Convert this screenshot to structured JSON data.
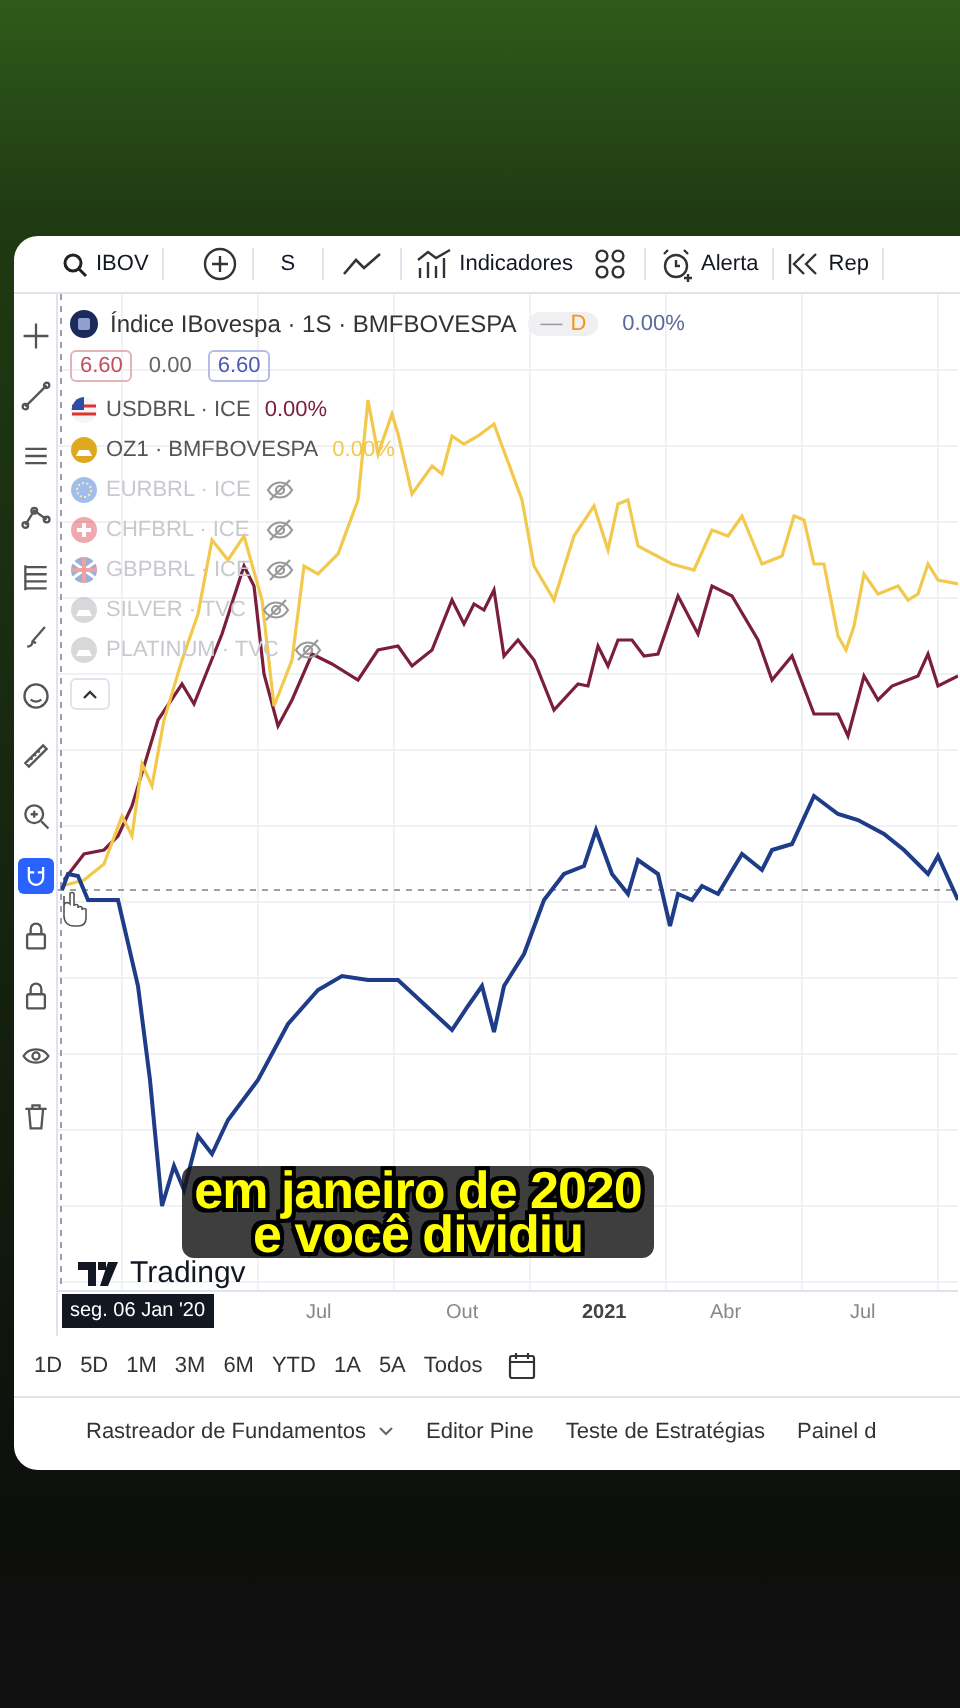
{
  "toolbar": {
    "symbol": "IBOV",
    "interval": "S",
    "buttons": [
      {
        "kind": "indicators",
        "label": "Indicadores"
      },
      {
        "kind": "alert",
        "label": "Alerta"
      },
      {
        "kind": "replay",
        "label": "Rep"
      }
    ]
  },
  "left_toolbar": [
    {
      "kind": "crosshair",
      "selected": false
    },
    {
      "kind": "trend-line",
      "selected": false
    },
    {
      "kind": "parallel",
      "selected": false
    },
    {
      "kind": "nodes",
      "selected": false
    },
    {
      "kind": "fib",
      "selected": false
    },
    {
      "kind": "brush",
      "selected": false
    },
    {
      "kind": "smiley",
      "selected": false
    },
    {
      "kind": "ruler",
      "selected": false
    },
    {
      "kind": "zoom",
      "selected": false
    },
    {
      "kind": "magnet",
      "selected": true
    },
    {
      "kind": "lock",
      "selected": false
    },
    {
      "kind": "lock",
      "selected": false
    },
    {
      "kind": "eye",
      "selected": false
    },
    {
      "kind": "trash",
      "selected": false
    }
  ],
  "legend": {
    "title": "Índice IBovespa · 1S · BMFBOVESPA",
    "status": "—",
    "status_flag": "D",
    "change": "0.00%",
    "color": "#1f3c88",
    "prices": [
      {
        "kind": "sell",
        "text": "6.60"
      },
      {
        "kind": "spread",
        "text": "0.00"
      },
      {
        "kind": "buy",
        "text": "6.60"
      }
    ],
    "series": [
      {
        "kind": "us",
        "name": "USDBRL · ICE",
        "change": "0.00%",
        "hidden": false,
        "color": "#7b1e3c"
      },
      {
        "kind": "gold",
        "name": "OZ1 · BMFBOVESPA",
        "change": "0.00%",
        "hidden": false,
        "color": "#f2c94c"
      },
      {
        "kind": "eu",
        "name": "EURBRL · ICE",
        "hidden": true
      },
      {
        "kind": "ch",
        "name": "CHFBRL · ICE",
        "hidden": true
      },
      {
        "kind": "uk",
        "name": "GBPBRL · ICE",
        "hidden": true
      },
      {
        "kind": "metal",
        "name": "SILVER · TVC",
        "hidden": true
      },
      {
        "kind": "metal",
        "name": "PLATINUM · TVC",
        "hidden": true
      }
    ]
  },
  "chart": {
    "logo": "Tradingv",
    "cursor_date": "seg. 06 Jan '20",
    "time_labels": [
      {
        "label": "Jul",
        "bold": false
      },
      {
        "label": "Out",
        "bold": false
      },
      {
        "label": "2021",
        "bold": true
      },
      {
        "label": "Abr",
        "bold": false
      },
      {
        "label": "Jul",
        "bold": false
      }
    ]
  },
  "caption": [
    "em janeiro de 2020",
    "e você dividiu"
  ],
  "timeframes": [
    "1D",
    "5D",
    "1M",
    "3M",
    "6M",
    "YTD",
    "1A",
    "5A",
    "Todos"
  ],
  "bottom_tabs": [
    {
      "label": "Rastreador de Fundamentos",
      "dropdown": true
    },
    {
      "label": "Editor Pine",
      "dropdown": false
    },
    {
      "label": "Teste de Estratégias",
      "dropdown": false
    },
    {
      "label": "Painel d",
      "dropdown": false
    }
  ]
}
